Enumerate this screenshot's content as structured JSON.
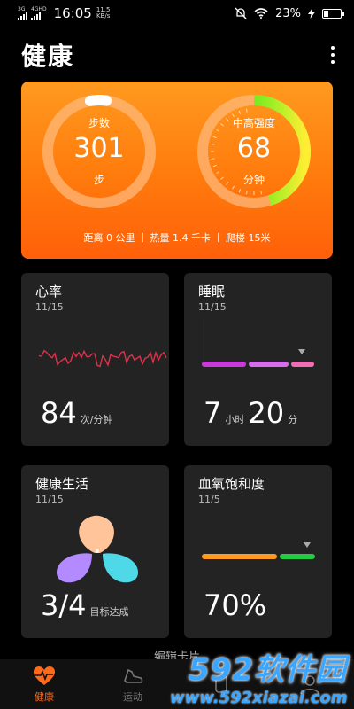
{
  "status": {
    "sig1": "3G",
    "sig2": "4GHD",
    "time": "16:05",
    "speed_value": "11.5",
    "speed_unit": "KB/s",
    "battery": "23%"
  },
  "header": {
    "title": "健康"
  },
  "summary": {
    "steps": {
      "label": "步数",
      "value": "301",
      "unit": "步",
      "progress": 0.05
    },
    "intensity": {
      "label": "中高强度",
      "value": "68",
      "unit": "分钟",
      "progress": 0.45
    },
    "stats": [
      "距离 0 公里",
      "热量 1.4 千卡",
      "爬楼 15米"
    ],
    "colors": {
      "ring_track": "#ffb87a",
      "green": "#22dd22",
      "yellow": "#ffee33"
    }
  },
  "tiles": {
    "heart_rate": {
      "title": "心率",
      "date": "11/15",
      "value": "84",
      "unit": "次/分钟",
      "color": "#e0304a"
    },
    "sleep": {
      "title": "睡眠",
      "date": "11/15",
      "hours": "7",
      "hours_unit": "小时",
      "minutes": "20",
      "minutes_unit": "分",
      "segments": [
        "#c63ad8",
        "#d86cea",
        "#ee6fb0"
      ]
    },
    "healthy_life": {
      "title": "健康生活",
      "date": "11/15",
      "value": "3/4",
      "unit": "目标达成",
      "petal_colors": [
        "#ffc49a",
        "#b38aff",
        "#4fd8e8"
      ]
    },
    "spo2": {
      "title": "血氧饱和度",
      "date": "11/5",
      "value": "70%",
      "segments": [
        "#ff9a1f",
        "#22cc44"
      ]
    }
  },
  "edit_card": "编辑卡片",
  "nav": [
    {
      "label": "健康",
      "icon": "heart-pulse-icon"
    },
    {
      "label": "运动",
      "icon": "shoe-icon"
    },
    {
      "label": "",
      "icon": "device-icon"
    },
    {
      "label": "",
      "icon": "profile-icon"
    }
  ],
  "watermark": {
    "main": "592软件园",
    "sub": "www.592xiazai.com"
  }
}
